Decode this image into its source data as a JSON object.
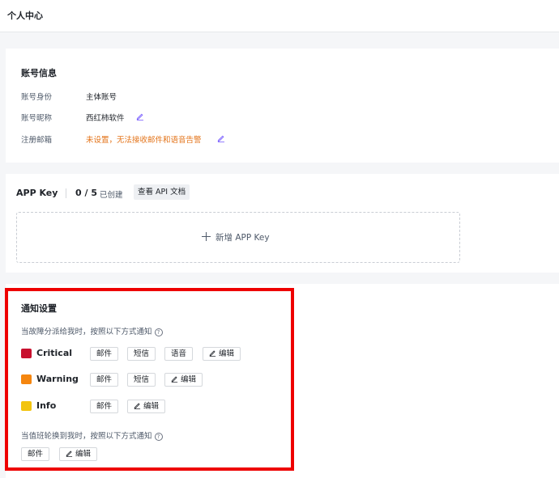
{
  "header": {
    "title": "个人中心"
  },
  "account": {
    "title": "账号信息",
    "rows": [
      {
        "label": "账号身份",
        "value": "主体账号"
      },
      {
        "label": "账号昵称",
        "value": "西红柿软件"
      },
      {
        "label": "注册邮箱",
        "value": "未设置，无法接收邮件和语音告警"
      }
    ]
  },
  "apikey": {
    "title": "APP Key",
    "count": "0 / 5",
    "created_label": "已创建",
    "doc_button": "查看 API 文档",
    "add_label": "新增 APP Key"
  },
  "notify": {
    "title": "通知设置",
    "assign_hint": "当故障分派给我时，按照以下方式通知",
    "levels": [
      {
        "name": "Critical",
        "color": "#c8102e",
        "channels": [
          "邮件",
          "短信",
          "语音"
        ],
        "edit": "编辑"
      },
      {
        "name": "Warning",
        "color": "#f5860f",
        "channels": [
          "邮件",
          "短信"
        ],
        "edit": "编辑"
      },
      {
        "name": "Info",
        "color": "#f2c40f",
        "channels": [
          "邮件"
        ],
        "edit": "编辑"
      }
    ],
    "shift_hint": "当值班轮换到我时，按照以下方式通知",
    "shift_channels": [
      "邮件"
    ],
    "shift_edit": "编辑"
  }
}
